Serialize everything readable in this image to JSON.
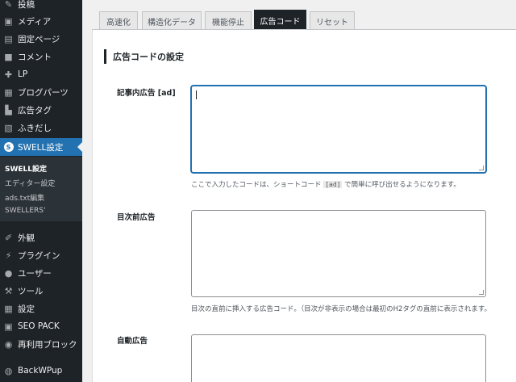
{
  "sidebar": {
    "items": [
      {
        "label": "投稿",
        "icon": "pin-icon"
      },
      {
        "label": "メディア",
        "icon": "media-icon"
      },
      {
        "label": "固定ページ",
        "icon": "page-icon"
      },
      {
        "label": "コメント",
        "icon": "comment-icon"
      },
      {
        "label": "LP",
        "icon": "lp-icon"
      },
      {
        "label": "ブログパーツ",
        "icon": "blogparts-icon"
      },
      {
        "label": "広告タグ",
        "icon": "adtag-icon"
      },
      {
        "label": "ふきだし",
        "icon": "balloon-icon"
      },
      {
        "label": "SWELL設定",
        "icon": "swell-icon"
      }
    ],
    "submenu": [
      "SWELL設定",
      "エディター設定",
      "ads.txt編集",
      "SWELLERS'"
    ],
    "items_bottom": [
      {
        "label": "外観",
        "icon": "brush-icon"
      },
      {
        "label": "プラグイン",
        "icon": "plugin-icon"
      },
      {
        "label": "ユーザー",
        "icon": "user-icon"
      },
      {
        "label": "ツール",
        "icon": "wrench-icon"
      },
      {
        "label": "設定",
        "icon": "settings-icon"
      },
      {
        "label": "SEO PACK",
        "icon": "seopack-icon"
      },
      {
        "label": "再利用ブロック",
        "icon": "reuse-icon"
      },
      {
        "label": "BackWPup",
        "icon": "backwpup-icon"
      }
    ]
  },
  "tabs": [
    "高速化",
    "構造化データ",
    "機能停止",
    "広告コード",
    "リセット"
  ],
  "section_title": "広告コードの設定",
  "fields": [
    {
      "label": "記事内広告 [ad]",
      "help_before": "ここで入力したコードは、ショートコード ",
      "help_code": "[ad]",
      "help_after": " で簡単に呼び出せるようになります。"
    },
    {
      "label": "目次前広告",
      "help": "目次の直前に挿入する広告コード。（目次が非表示の場合は最初のH2タグの直前に表示されます。"
    },
    {
      "label": "自動広告"
    }
  ]
}
